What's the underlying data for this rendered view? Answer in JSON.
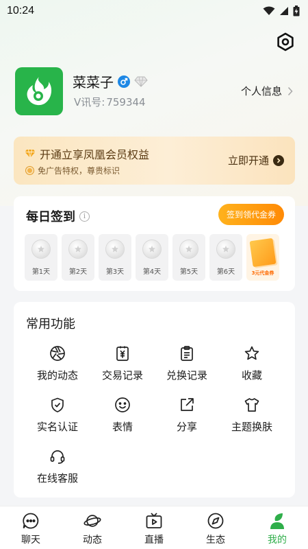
{
  "status": {
    "time": "10:24"
  },
  "profile": {
    "nickname": "菜菜子",
    "uid_label": "V讯号:",
    "uid_value": "759344",
    "link_label": "个人信息"
  },
  "vip": {
    "title": "开通立享凤凰会员权益",
    "subtitle": "免广告特权，尊贵标识",
    "action": "立即开通"
  },
  "sign_in": {
    "title": "每日签到",
    "button": "签到领代金券",
    "days": [
      "第1天",
      "第2天",
      "第3天",
      "第4天",
      "第5天",
      "第6天"
    ],
    "day7_text": "3元代金券"
  },
  "functions": {
    "title": "常用功能",
    "items": [
      {
        "label": "我的动态",
        "icon": "aperture-icon"
      },
      {
        "label": "交易记录",
        "icon": "receipt-icon"
      },
      {
        "label": "兑换记录",
        "icon": "clipboard-icon"
      },
      {
        "label": "收藏",
        "icon": "star-icon"
      },
      {
        "label": "实名认证",
        "icon": "shield-check-icon"
      },
      {
        "label": "表情",
        "icon": "smile-icon"
      },
      {
        "label": "分享",
        "icon": "share-icon"
      },
      {
        "label": "主题换肤",
        "icon": "shirt-icon"
      },
      {
        "label": "在线客服",
        "icon": "headset-icon"
      }
    ]
  },
  "tabs": [
    {
      "label": "聊天",
      "icon": "chat-icon",
      "active": false
    },
    {
      "label": "动态",
      "icon": "planet-icon",
      "active": false
    },
    {
      "label": "直播",
      "icon": "tv-icon",
      "active": false
    },
    {
      "label": "生态",
      "icon": "compass-icon",
      "active": false
    },
    {
      "label": "我的",
      "icon": "profile-leaf-icon",
      "active": true
    }
  ],
  "colors": {
    "accent_green": "#2fae4a",
    "vip_gold": "#fbe6c0",
    "sign_orange": "#ff9a0d",
    "gender_blue": "#1e88e5"
  }
}
